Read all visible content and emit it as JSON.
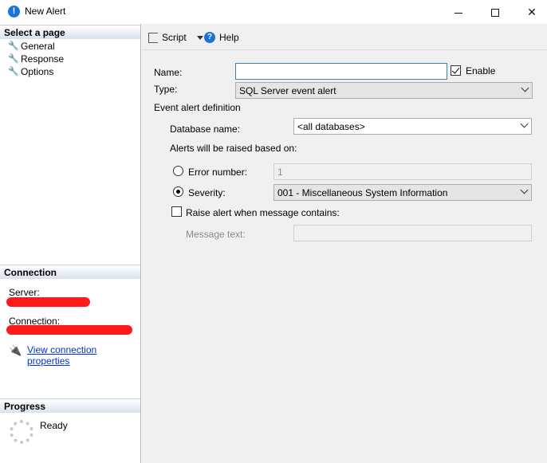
{
  "window": {
    "title": "New Alert",
    "icon_name": "alert-icon",
    "icon_glyph": "!"
  },
  "left": {
    "select_page_header": "Select a page",
    "pages": [
      {
        "label": "General",
        "icon": "wrench-icon"
      },
      {
        "label": "Response",
        "icon": "wrench-icon"
      },
      {
        "label": "Options",
        "icon": "wrench-icon"
      }
    ],
    "connection_header": "Connection",
    "server_label": "Server:",
    "connection_label": "Connection:",
    "view_connection_link": "View connection properties",
    "progress_header": "Progress",
    "progress_status": "Ready"
  },
  "toolbar": {
    "script_label": "Script",
    "help_label": "Help"
  },
  "form": {
    "name_label": "Name:",
    "name_value": "",
    "enable_label": "Enable",
    "enable_checked": true,
    "type_label": "Type:",
    "type_value": "SQL Server event alert",
    "event_def_label": "Event alert definition",
    "database_label": "Database name:",
    "database_value": "<all databases>",
    "raised_label": "Alerts will be raised based on:",
    "error_number_label": "Error number:",
    "error_number_value": "1",
    "severity_label": "Severity:",
    "severity_value": "001 - Miscellaneous System Information",
    "selected_option": "severity",
    "raise_label": "Raise alert when message contains:",
    "raise_checked": false,
    "message_label": "Message text:",
    "message_value": ""
  },
  "colors": {
    "accent": "#1a73d9",
    "redaction": "#ff1a1a",
    "link": "#0033cc"
  }
}
